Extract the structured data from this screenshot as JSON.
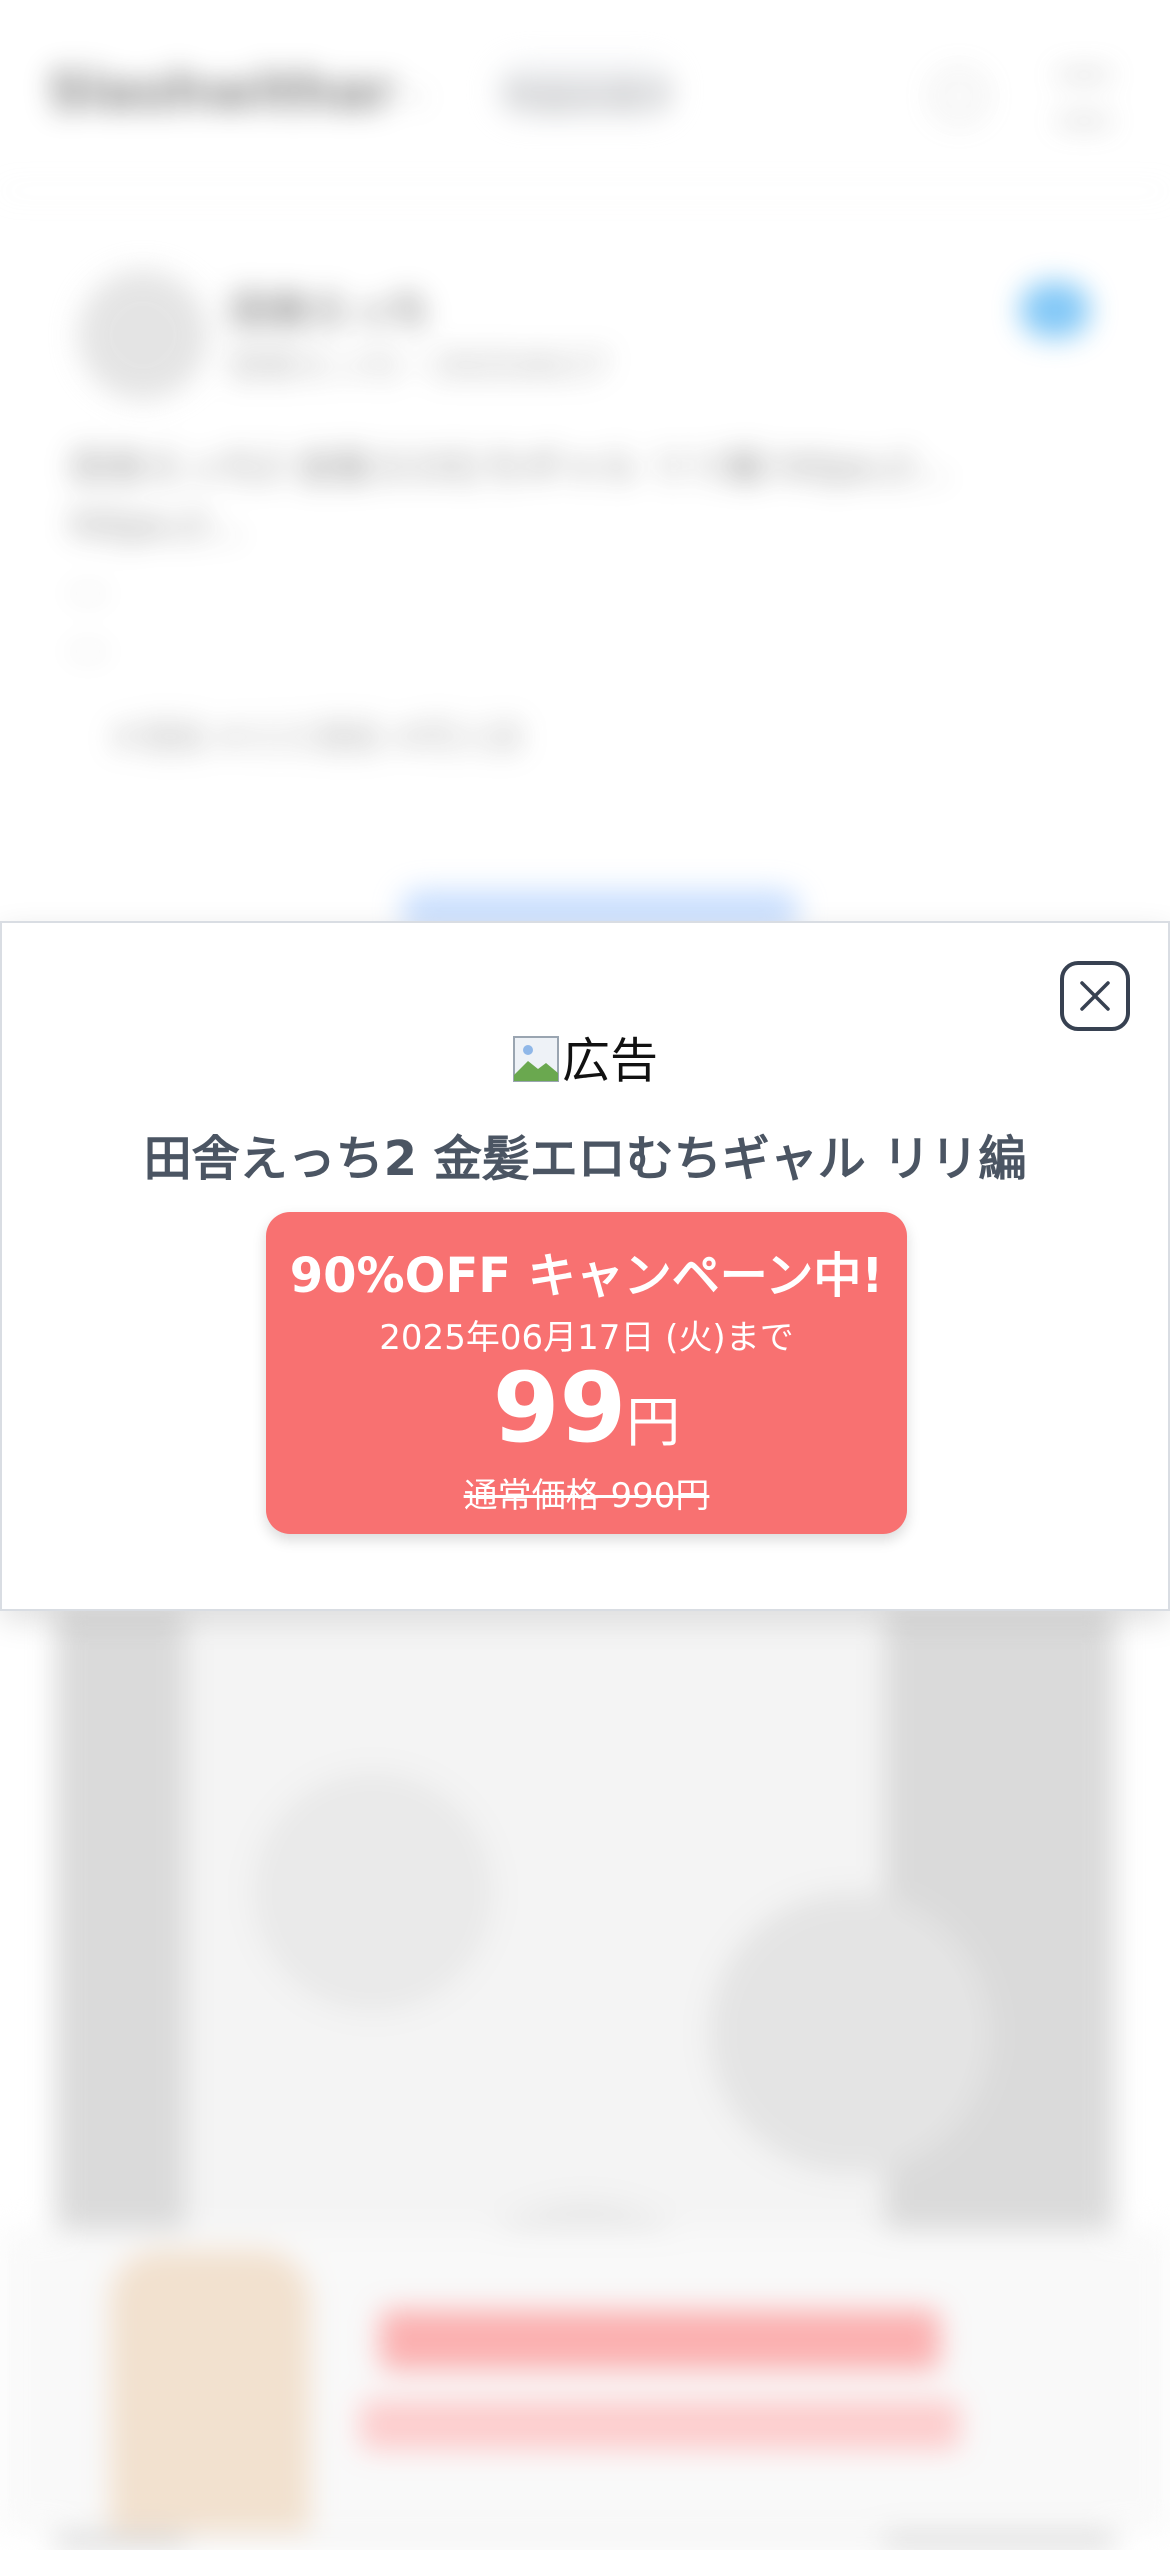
{
  "background": {
    "logo": "Slashwithar",
    "search_text": "作品を探す",
    "author": "田舎えっち",
    "meta": "田舎えっち・2025/6/17",
    "body_lines": [
      "田舎えっち2 金髪エロむちギャル リリ編 https://...",
      "https://...",
      "...",
      "..."
    ],
    "tags": "#漫画 #エロ漫画 #同人誌"
  },
  "modal": {
    "ad_label": "広告",
    "title": "田舎えっち2 金髪エロむちギャル リリ編",
    "promo": {
      "headline": "90%OFF キャンペーン中!",
      "deadline": "2025年06月17日 (火)まで",
      "price": "99",
      "currency": "円",
      "regular_price": "通常価格 990円"
    },
    "colors": {
      "promo_bg": "#f87171",
      "title_color": "#4b5563"
    },
    "close_icon": "close-icon"
  }
}
